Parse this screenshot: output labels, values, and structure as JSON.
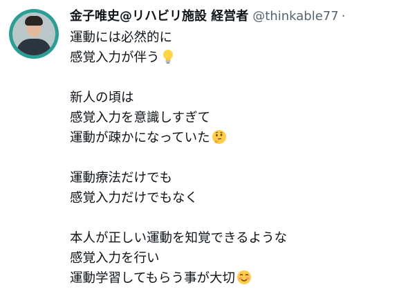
{
  "header": {
    "name": "金子唯史@リハビリ施設 経営者",
    "handle": "@thinkable77",
    "separator": "·"
  },
  "tweet": {
    "lines": [
      "運動には必然的に",
      "感覚入力が伴う",
      "",
      "新人の頃は",
      "感覚入力を意識しすぎて",
      "運動が疎かになっていた",
      "",
      "運動療法だけでも",
      "感覚入力だけでもなく",
      "",
      "本人が正しい運動を知覚できるような",
      "感覚入力を行い",
      "運動学習してもらう事が大切"
    ],
    "emojis": {
      "line_2": "lightbulb-icon",
      "line_6": "thinking-face-icon",
      "line_13": "smiling-face-icon"
    }
  }
}
